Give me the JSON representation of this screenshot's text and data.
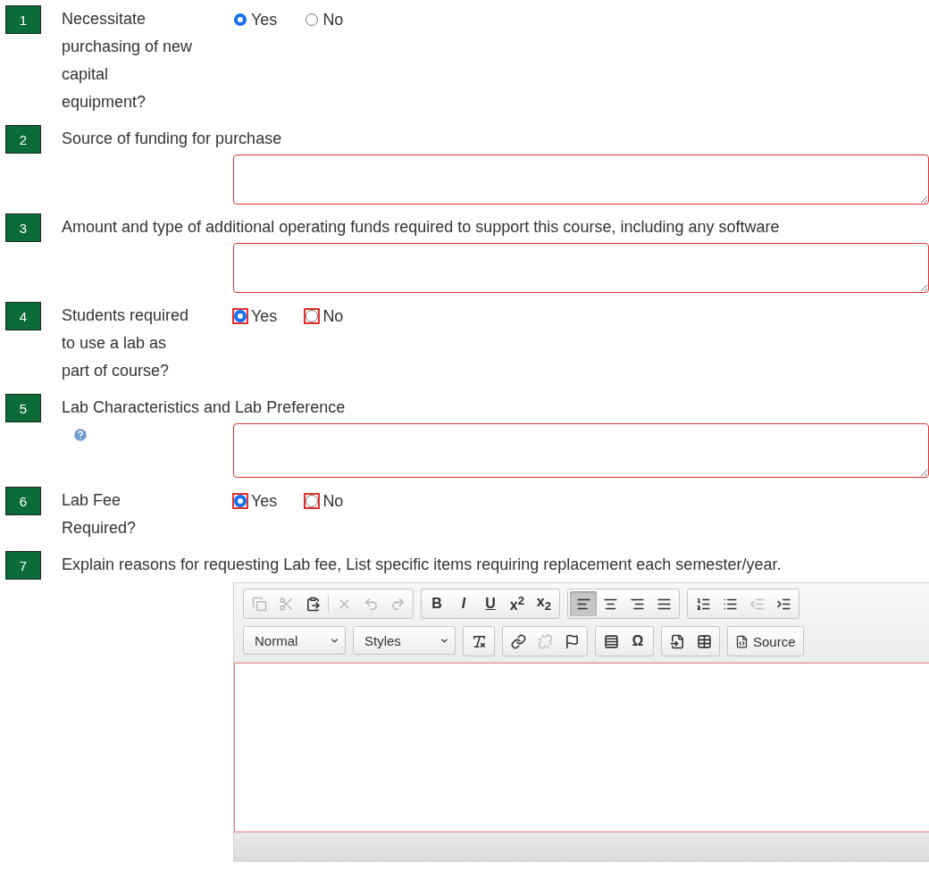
{
  "questions": [
    {
      "number": "1",
      "kind": "radio",
      "label": "Necessitate\npurchasing of new\ncapital\nequipment?",
      "invalid": false,
      "options": [
        {
          "label": "Yes",
          "selected": true
        },
        {
          "label": "No",
          "selected": false
        }
      ]
    },
    {
      "number": "2",
      "kind": "textarea",
      "label": "Source of funding for purchase",
      "invalid": true,
      "help": false
    },
    {
      "number": "3",
      "kind": "textarea",
      "label": "Amount and type of additional operating funds required to support this course, including any software",
      "invalid": true,
      "help": false
    },
    {
      "number": "4",
      "kind": "radio",
      "label": "Students required\nto use a lab as\npart of course?",
      "invalid": true,
      "options": [
        {
          "label": "Yes",
          "selected": true
        },
        {
          "label": "No",
          "selected": false
        }
      ]
    },
    {
      "number": "5",
      "kind": "textarea",
      "label": "Lab Characteristics and Lab Preference",
      "invalid": true,
      "help": true
    },
    {
      "number": "6",
      "kind": "radio",
      "label": "Lab Fee\nRequired?",
      "invalid": true,
      "options": [
        {
          "label": "Yes",
          "selected": true
        },
        {
          "label": "No",
          "selected": false
        }
      ]
    },
    {
      "number": "7",
      "kind": "editor",
      "label": "Explain reasons for requesting Lab fee, List specific items requiring replacement each semester/year.",
      "invalid": true,
      "toolbar": [
        [
          [
            {
              "kind": "icon",
              "disabled": true,
              "on": false
            },
            {
              "kind": "icon",
              "disabled": true,
              "on": false
            },
            {
              "kind": "icon",
              "disabled": false,
              "on": false
            },
            {
              "kind": "separator"
            },
            {
              "kind": "icon",
              "disabled": true,
              "on": false
            },
            {
              "kind": "icon",
              "disabled": true,
              "on": false
            },
            {
              "kind": "icon",
              "disabled": true,
              "on": false
            }
          ],
          [
            {
              "kind": "text",
              "label": "B",
              "disabled": false,
              "on": false
            },
            {
              "kind": "text",
              "label": "I",
              "disabled": false,
              "on": false
            },
            {
              "kind": "text",
              "label": "U",
              "disabled": false,
              "on": false
            },
            {
              "kind": "text",
              "label": "x$^{2}$",
              "disabled": false,
              "on": false
            },
            {
              "kind": "text",
              "label": "x$_{2}$",
              "disabled": false,
              "on": false
            }
          ],
          [
            {
              "kind": "icon",
              "disabled": false,
              "on": true
            },
            {
              "kind": "icon",
              "disabled": false,
              "on": false
            },
            {
              "kind": "icon",
              "disabled": false,
              "on": false
            },
            {
              "kind": "icon",
              "disabled": false,
              "on": false
            }
          ],
          [
            {
              "kind": "icon",
              "disabled": false,
              "on": false
            },
            {
              "kind": "icon",
              "disabled": false,
              "on": false
            },
            {
              "kind": "icon",
              "disabled": true,
              "on": false
            },
            {
              "kind": "icon",
              "disabled": false,
              "on": false
            }
          ]
        ],
        [
          [
            {
              "kind": "dropdown",
              "label": "Normal"
            }
          ],
          [
            {
              "kind": "dropdown",
              "label": "Styles"
            }
          ],
          [
            {
              "kind": "icon",
              "disabled": false,
              "on": false
            }
          ],
          [
            {
              "kind": "icon",
              "disabled": false,
              "on": false
            },
            {
              "kind": "icon",
              "disabled": true,
              "on": false
            },
            {
              "kind": "icon",
              "disabled": false,
              "on": false
            }
          ],
          [
            {
              "kind": "icon",
              "disabled": false,
              "on": false
            },
            {
              "kind": "text",
              "label": "Ω",
              "disabled": false,
              "on": false
            }
          ],
          [
            {
              "kind": "icon",
              "disabled": false,
              "on": false
            },
            {
              "kind": "icon",
              "disabled": false,
              "on": false
            }
          ],
          [
            {
              "kind": "labeled",
              "label": "Source",
              "disabled": false,
              "on": false
            }
          ]
        ]
      ]
    }
  ]
}
